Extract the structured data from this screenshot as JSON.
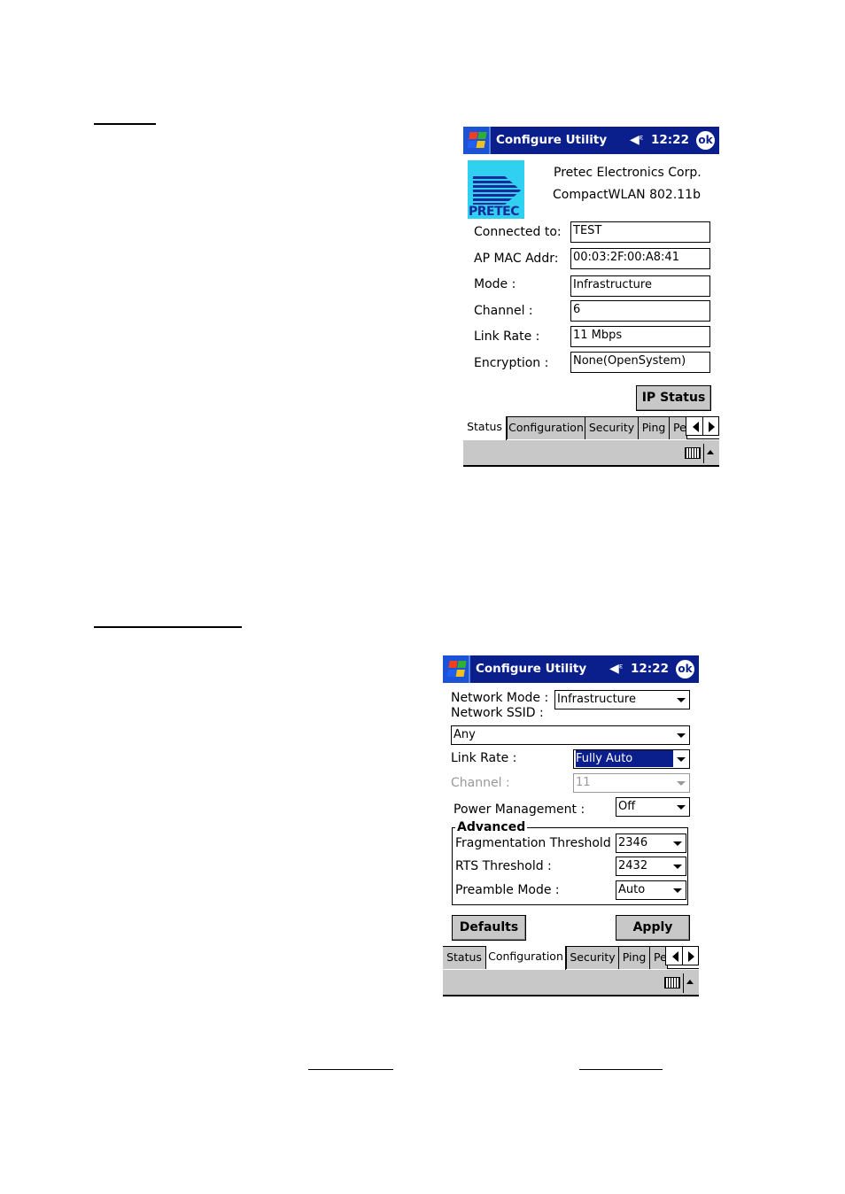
{
  "screen1": {
    "titlebar": {
      "title": "Configure Utility",
      "time": "12:22",
      "ok": "ok",
      "icons": [
        "start-menu-windows-flag-icon",
        "speaker-muted-icon",
        "ok-button-icon"
      ]
    },
    "header": {
      "logo_text": "PRETEC",
      "company": "Pretec Electronics Corp.",
      "product": "CompactWLAN 802.11b"
    },
    "fields": [
      {
        "label": "Connected to:",
        "value": "TEST"
      },
      {
        "label": "AP MAC Addr:",
        "value": "00:03:2F:00:A8:41"
      },
      {
        "label": "Mode :",
        "value": "Infrastructure"
      },
      {
        "label": "Channel :",
        "value": "6"
      },
      {
        "label": "Link Rate :",
        "value": "11 Mbps"
      },
      {
        "label": "Encryption :",
        "value": "None(OpenSystem)"
      }
    ],
    "ip_status_button": "IP Status",
    "tabs": [
      {
        "label": "Status",
        "active": true
      },
      {
        "label": "Configuration",
        "active": false
      },
      {
        "label": "Security",
        "active": false
      },
      {
        "label": "Ping",
        "active": false
      },
      {
        "label": "Pe",
        "active": false
      }
    ]
  },
  "screen2": {
    "titlebar": {
      "title": "Configure Utility",
      "time": "12:22",
      "ok": "ok"
    },
    "network_mode": {
      "label": "Network Mode :",
      "value": "Infrastructure"
    },
    "network_ssid": {
      "label": "Network SSID :",
      "value": "Any"
    },
    "link_rate": {
      "label": "Link Rate :",
      "value": "Fully Auto"
    },
    "channel": {
      "label": "Channel :",
      "value": "11",
      "disabled": true
    },
    "power_management": {
      "label": "Power Management :",
      "value": "Off"
    },
    "advanced": {
      "title": "Advanced",
      "fragmentation": {
        "label": "Fragmentation Threshold :",
        "value": "2346"
      },
      "rts": {
        "label": "RTS Threshold :",
        "value": "2432"
      },
      "preamble": {
        "label": "Preamble Mode :",
        "value": "Auto"
      }
    },
    "defaults_button": "Defaults",
    "apply_button": "Apply",
    "tabs": [
      {
        "label": "Status",
        "active": false
      },
      {
        "label": "Configuration",
        "active": true
      },
      {
        "label": "Security",
        "active": false
      },
      {
        "label": "Ping",
        "active": false
      },
      {
        "label": "Pe",
        "active": false
      }
    ]
  }
}
